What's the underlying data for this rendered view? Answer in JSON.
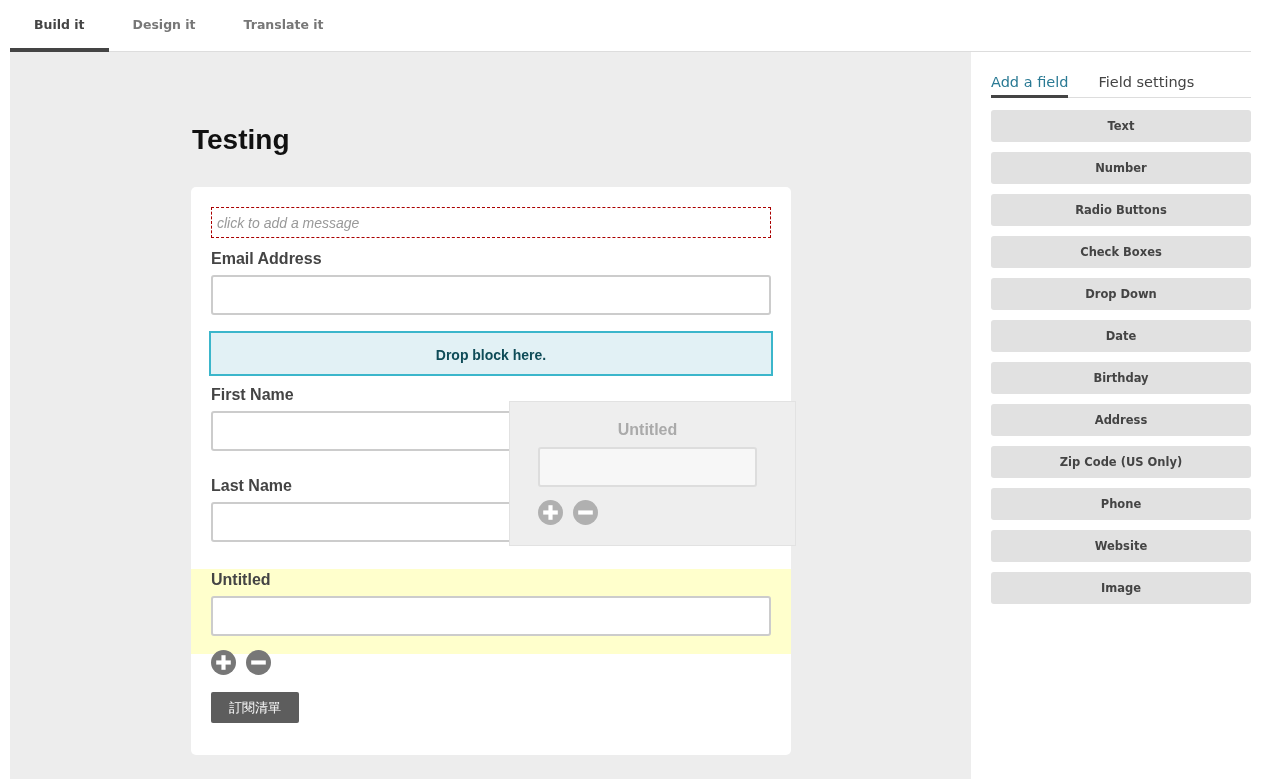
{
  "tabs": [
    {
      "label": "Build it",
      "selected": true
    },
    {
      "label": "Design it",
      "selected": false
    },
    {
      "label": "Translate it",
      "selected": false
    }
  ],
  "form": {
    "title": "Testing",
    "items": [
      {
        "kind": "message",
        "placeholder": "click to add a message"
      },
      {
        "kind": "field",
        "label": "Email Address",
        "highlighted": false,
        "controls": false
      },
      {
        "kind": "drop_zone",
        "label": "Drop block here."
      },
      {
        "kind": "field",
        "label": "First Name",
        "highlighted": false,
        "controls": false
      },
      {
        "kind": "field",
        "label": "Last Name",
        "highlighted": false,
        "controls": false
      },
      {
        "kind": "field",
        "label": "Untitled",
        "highlighted": true,
        "controls": true
      }
    ],
    "submit": "訂閱清單"
  },
  "drag_preview": {
    "label": "Untitled"
  },
  "side_panel": {
    "tabs": [
      {
        "label": "Add a field",
        "selected": true
      },
      {
        "label": "Field settings",
        "selected": false
      }
    ],
    "field_types": [
      "Text",
      "Number",
      "Radio Buttons",
      "Check Boxes",
      "Drop Down",
      "Date",
      "Birthday",
      "Address",
      "Zip Code (US Only)",
      "Phone",
      "Website",
      "Image"
    ]
  }
}
